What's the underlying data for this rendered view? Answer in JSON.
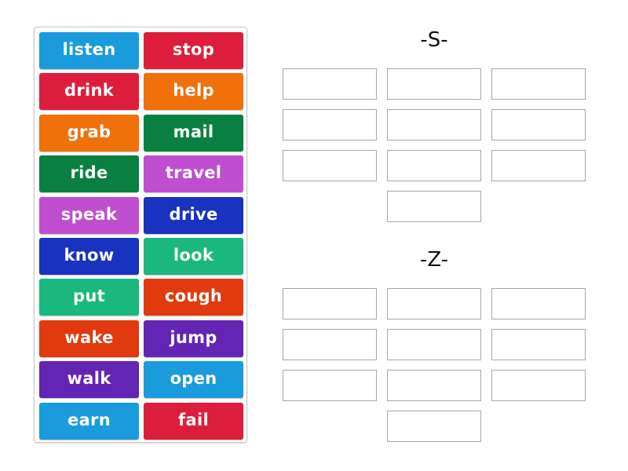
{
  "colors": {
    "blue": "#1a9bdc",
    "red": "#dc1e3c",
    "orange": "#f0700a",
    "green": "#0a8040",
    "magenta": "#c04ed0",
    "navy": "#1a32c0",
    "teal": "#1ab87e",
    "vermilion": "#e03a0e",
    "purple": "#6424b4"
  },
  "tiles": [
    {
      "label": "listen",
      "color": "#1a9bdc"
    },
    {
      "label": "stop",
      "color": "#dc1e3c"
    },
    {
      "label": "drink",
      "color": "#dc1e3c"
    },
    {
      "label": "help",
      "color": "#f0700a"
    },
    {
      "label": "grab",
      "color": "#f0700a"
    },
    {
      "label": "mail",
      "color": "#0a8040"
    },
    {
      "label": "ride",
      "color": "#0a8040"
    },
    {
      "label": "travel",
      "color": "#c04ed0"
    },
    {
      "label": "speak",
      "color": "#c04ed0"
    },
    {
      "label": "drive",
      "color": "#1a32c0"
    },
    {
      "label": "know",
      "color": "#1a32c0"
    },
    {
      "label": "look",
      "color": "#1ab87e"
    },
    {
      "label": "put",
      "color": "#1ab87e"
    },
    {
      "label": "cough",
      "color": "#e03a0e"
    },
    {
      "label": "wake",
      "color": "#e03a0e"
    },
    {
      "label": "jump",
      "color": "#6424b4"
    },
    {
      "label": "walk",
      "color": "#6424b4"
    },
    {
      "label": "open",
      "color": "#1a9bdc"
    },
    {
      "label": "earn",
      "color": "#1a9bdc"
    },
    {
      "label": "fail",
      "color": "#dc1e3c"
    }
  ],
  "groups": [
    {
      "heading": "-S-",
      "slots": 10
    },
    {
      "heading": "-Z-",
      "slots": 10
    }
  ]
}
